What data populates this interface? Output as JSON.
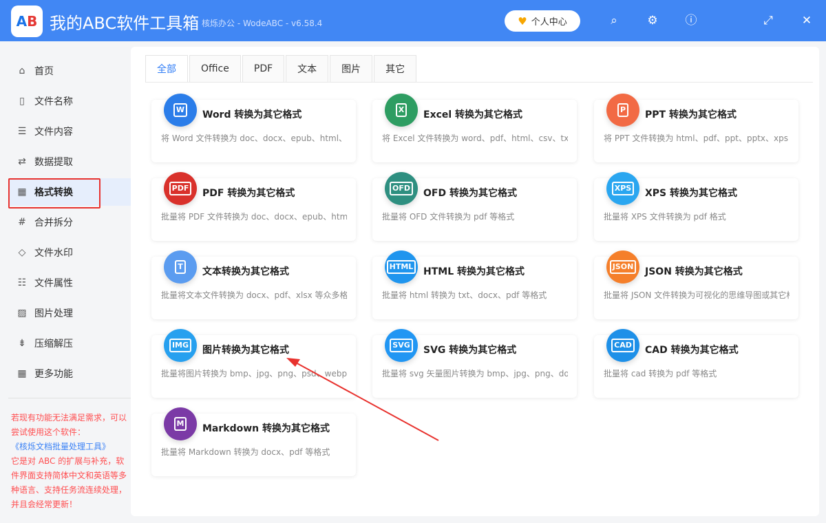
{
  "app": {
    "title": "我的ABC软件工具箱",
    "subtitle": "核烁办公 - WodeABC - v6.58.4",
    "logo_text": "AB",
    "user_center": "个人中心"
  },
  "toolbar_icons": [
    "search-icon",
    "gear-icon",
    "help-icon",
    "maximize-icon",
    "close-icon"
  ],
  "sidebar": {
    "items": [
      {
        "label": "首页",
        "icon": "home-icon"
      },
      {
        "label": "文件名称",
        "icon": "file-name-icon"
      },
      {
        "label": "文件内容",
        "icon": "file-content-icon"
      },
      {
        "label": "数据提取",
        "icon": "data-extract-icon"
      },
      {
        "label": "格式转换",
        "icon": "format-convert-icon"
      },
      {
        "label": "合并拆分",
        "icon": "merge-split-icon"
      },
      {
        "label": "文件水印",
        "icon": "watermark-icon"
      },
      {
        "label": "文件属性",
        "icon": "file-properties-icon"
      },
      {
        "label": "图片处理",
        "icon": "image-icon"
      },
      {
        "label": "压缩解压",
        "icon": "compress-icon"
      },
      {
        "label": "更多功能",
        "icon": "more-icon"
      }
    ],
    "active": "格式转换",
    "promo": {
      "line1": "若现有功能无法满足需求，可以尝试使用这个软件：",
      "link": "《核烁文档批量处理工具》",
      "line2": "它是对 ABC 的扩展与补充，软件界面支持简体中文和英语等多种语言、支持任务流连续处理，并且会经常更新！"
    }
  },
  "tabs": [
    {
      "label": "全部",
      "active": true
    },
    {
      "label": "Office"
    },
    {
      "label": "PDF"
    },
    {
      "label": "文本"
    },
    {
      "label": "图片"
    },
    {
      "label": "其它"
    }
  ],
  "cards": [
    {
      "title": "Word 转换为其它格式",
      "desc": "将 Word 文件转换为 doc、docx、epub、html、pdf",
      "glyph": "W",
      "color": "#2b7de9"
    },
    {
      "title": "Excel 转换为其它格式",
      "desc": "将 Excel 文件转换为 word、pdf、html、csv、txt、s",
      "glyph": "X",
      "color": "#2e9d62"
    },
    {
      "title": "PPT 转换为其它格式",
      "desc": "将 PPT 文件转换为 html、pdf、ppt、pptx、xps 等才",
      "glyph": "P",
      "color": "#f26a44"
    },
    {
      "title": "PDF 转换为其它格式",
      "desc": "批量将 PDF 文件转换为 doc、docx、epub、html、",
      "glyph": "PDF",
      "color": "#d9312b"
    },
    {
      "title": "OFD 转换为其它格式",
      "desc": "批量将 OFD 文件转换为 pdf 等格式",
      "glyph": "OFD",
      "color": "#2e8f80"
    },
    {
      "title": "XPS 转换为其它格式",
      "desc": "批量将 XPS 文件转换为 pdf 格式",
      "glyph": "XPS",
      "color": "#2aa6f0"
    },
    {
      "title": "文本转换为其它格式",
      "desc": "批量将文本文件转换为 docx、pdf、xlsx 等众多格式",
      "glyph": "T",
      "color": "#5b9cf0"
    },
    {
      "title": "HTML 转换为其它格式",
      "desc": "批量将 html 转换为 txt、docx、pdf 等格式",
      "glyph": "HTML",
      "color": "#1f95ee"
    },
    {
      "title": "JSON 转换为其它格式",
      "desc": "批量将 JSON 文件转换为可视化的思维导图或其它格",
      "glyph": "JSON",
      "color": "#f57f2a"
    },
    {
      "title": "图片转换为其它格式",
      "desc": "批量将图片转换为 bmp、jpg、png、psd、webp、",
      "glyph": "IMG",
      "color": "#27a0ef"
    },
    {
      "title": "SVG 转换为其它格式",
      "desc": "批量将 svg 矢量图片转换为 bmp、jpg、png、docx",
      "glyph": "SVG",
      "color": "#2196f3"
    },
    {
      "title": "CAD 转换为其它格式",
      "desc": "批量将 cad 转换为 pdf 等格式",
      "glyph": "CAD",
      "color": "#1e90e8"
    },
    {
      "title": "Markdown 转换为其它格式",
      "desc": "批量将 Markdown 转换为 docx、pdf 等格式",
      "glyph": "M",
      "color": "#7b3aa6"
    }
  ]
}
